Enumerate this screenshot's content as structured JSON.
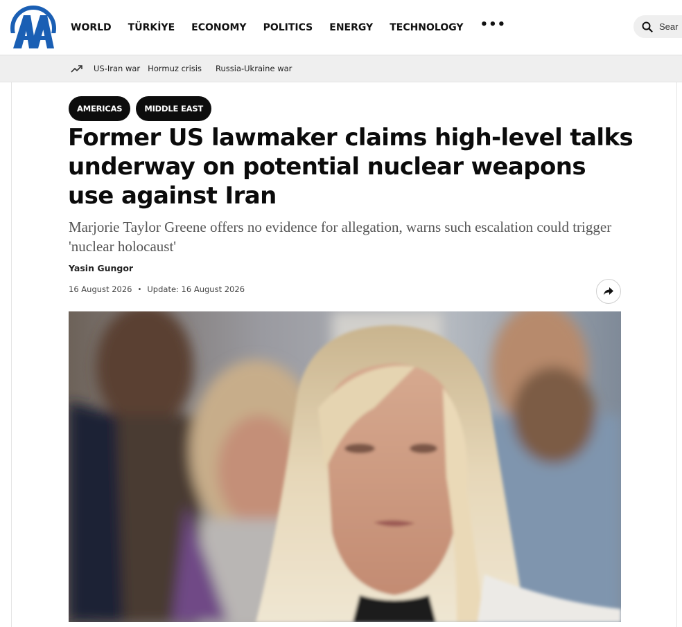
{
  "header": {
    "logo_text": "AA",
    "nav": [
      "WORLD",
      "TÜRKİYE",
      "ECONOMY",
      "POLITICS",
      "ENERGY",
      "TECHNOLOGY"
    ],
    "more_label": "•••",
    "search_placeholder": "Sear"
  },
  "trending": {
    "icon": "trending-up-icon",
    "items": [
      "US-Iran war",
      "Hormuz crisis",
      "Russia-Ukraine war"
    ]
  },
  "article": {
    "tags": [
      "AMERICAS",
      "MIDDLE EAST"
    ],
    "headline": "Former US lawmaker claims high-level talks underway on potential nuclear weapons use against Iran",
    "subheadline": "Marjorie Taylor Greene offers no evidence for allegation, warns such escalation could trigger 'nuclear holocaust'",
    "author": "Yasin Gungor",
    "published": "16 August 2026",
    "updated": "Update: 16 August 2026",
    "share_icon": "share-icon",
    "photo_icon": "article-photo"
  },
  "colors": {
    "brand": "#1a5fb4",
    "tag_bg": "#0d0d0d",
    "trending_bg": "#efefef"
  }
}
